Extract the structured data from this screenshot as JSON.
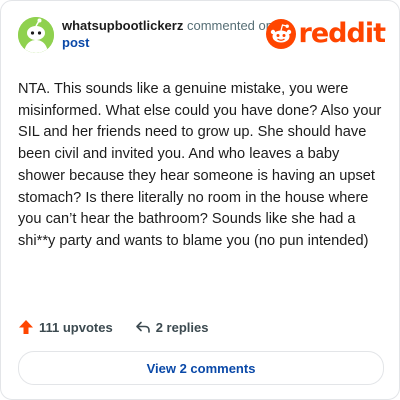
{
  "comment": {
    "username": "whatsupbootlickerz",
    "action_text": "commented on",
    "target": "post",
    "body": "NTA. This sounds like a genuine mistake, you were misinformed. What else could you have done? Also your SIL and her friends need to grow up. She should have been civil and invited you. And who leaves a baby shower because they hear someone is having an upset stomach? Is there literally no room in the house where you can’t hear the bathroom? Sounds like she had a shi**y party and wants to blame you (no pun intended)"
  },
  "brand": {
    "name": "reddit",
    "color": "#ff4500"
  },
  "actions": {
    "upvotes": "111 upvotes",
    "replies": "2 replies"
  },
  "view_button": "View 2 comments",
  "icons": {
    "avatar": "snoo-avatar-icon",
    "logo": "reddit-snoo-icon",
    "upvote": "upvote-arrow-icon",
    "reply": "reply-arrow-icon"
  },
  "colors": {
    "accent": "#ff4500",
    "link": "#0a49a8",
    "avatar_bg": "#8fd14f"
  }
}
